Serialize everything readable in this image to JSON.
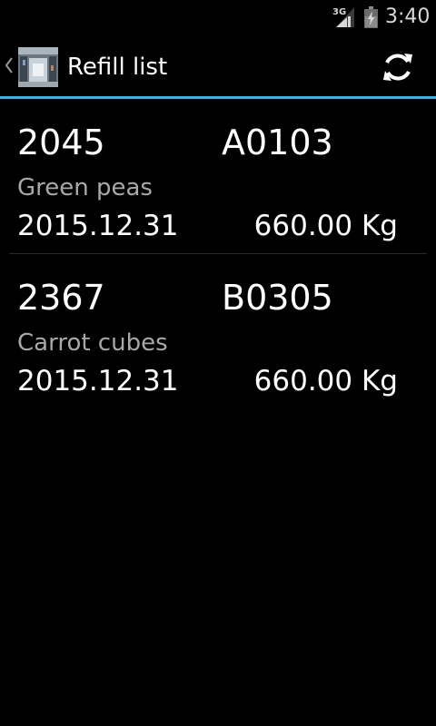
{
  "status_bar": {
    "network_label": "3G",
    "time": "3:40",
    "icons": [
      "signal-3g-icon",
      "battery-charging-icon"
    ]
  },
  "action_bar": {
    "title": "Refill list",
    "up_icon": "chevron-left-icon",
    "app_icon": "warehouse-app-icon",
    "refresh_icon": "refresh-icon"
  },
  "colors": {
    "accent": "#33b5e5",
    "background": "#000000",
    "secondary_text": "#a8a8a8"
  },
  "items": [
    {
      "number": "2045",
      "code": "A0103",
      "name": "Green peas",
      "date": "2015.12.31",
      "weight": "660.00 Kg"
    },
    {
      "number": "2367",
      "code": "B0305",
      "name": "Carrot cubes",
      "date": "2015.12.31",
      "weight": "660.00 Kg"
    }
  ]
}
